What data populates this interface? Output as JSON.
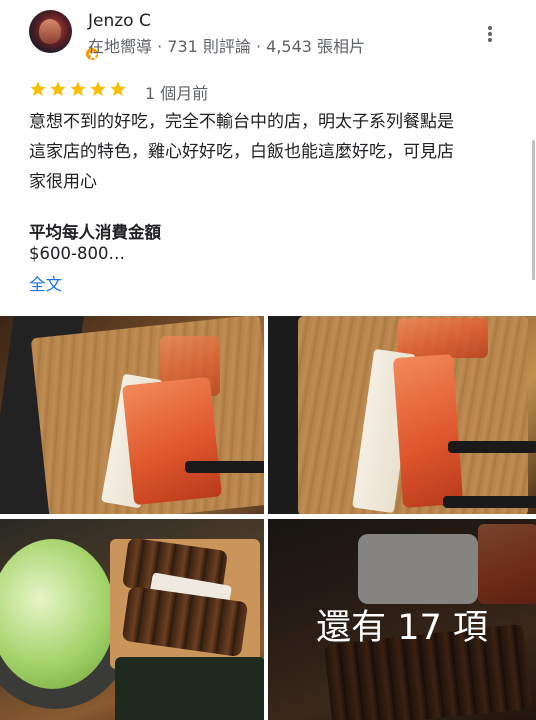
{
  "reviewer": {
    "name": "Jenzo C",
    "meta": "在地嚮導 · 731 則評論 · 4,543 張相片",
    "avatar_icon": "reviewer-avatar",
    "badge_icon": "local-guide-badge-icon",
    "badge_color": "#f29900"
  },
  "menu_icon": "more-vert-icon",
  "rating": {
    "stars": 5,
    "max": 5,
    "star_color": "#fbbc04"
  },
  "posted": "1 個月前",
  "review_lines": [
    "意想不到的好吃，完全不輸台中的店，明太子系列餐點是",
    "這家店的特色，雞心好好吃，白飯也能這麼好吃，可見店",
    "家很用心"
  ],
  "price": {
    "title": "平均每人消費金額",
    "value": "$600-800…"
  },
  "full_text_link": "全文",
  "link_color": "#1a73e8",
  "photos": {
    "more_label": "還有 17 項"
  }
}
